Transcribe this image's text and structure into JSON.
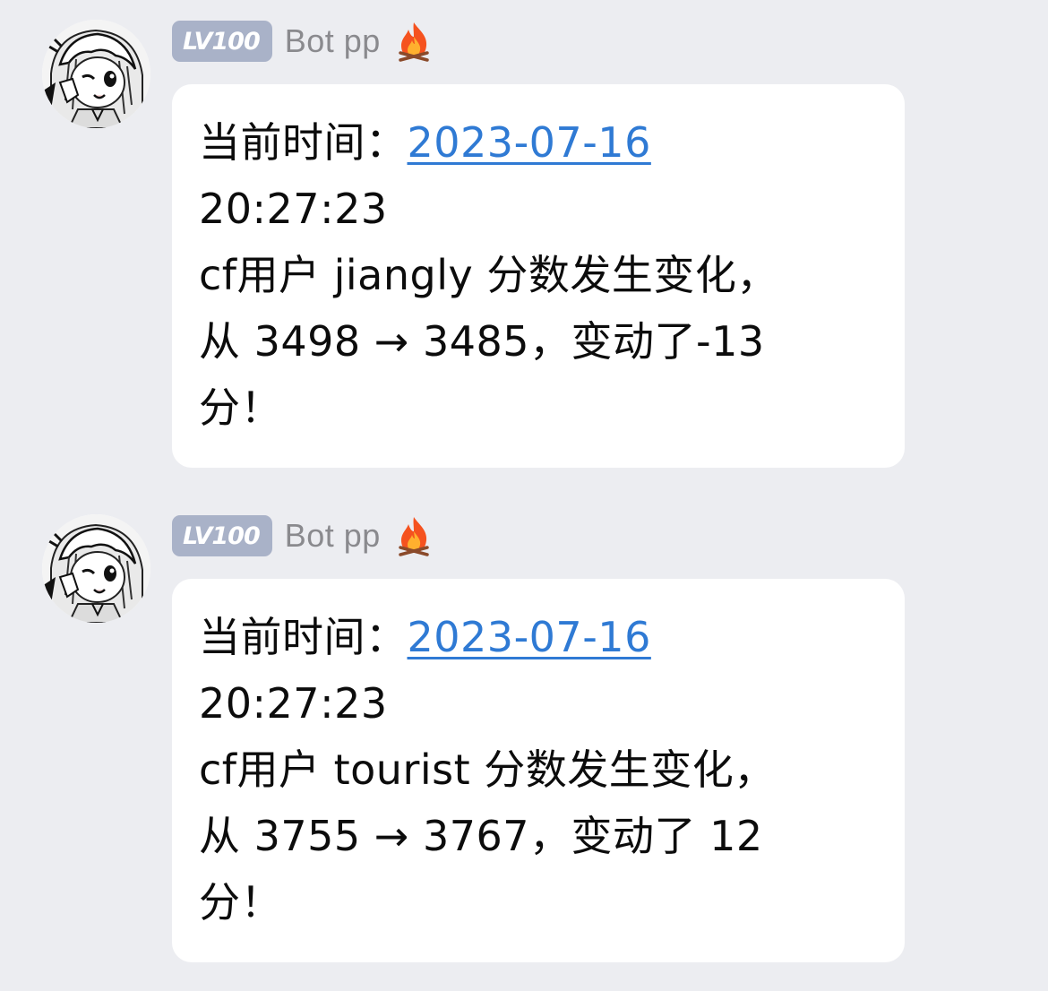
{
  "messages": [
    {
      "level_badge": "LV100",
      "sender": "Bot pp",
      "time_label": "当前时间：",
      "date": "2023-07-16",
      "time": "20:27:23",
      "line1": "cf用户 jiangly 分数发生变化，",
      "line2": "从 3498 → 3485，变动了-13",
      "line3": "分！",
      "flame_icon": "flame-icon",
      "avatar": "avatar"
    },
    {
      "level_badge": "LV100",
      "sender": "Bot pp",
      "time_label": "当前时间：",
      "date": "2023-07-16",
      "time": "20:27:23",
      "line1": "cf用户 tourist 分数发生变化，",
      "line2": "从 3755 → 3767，变动了 12",
      "line3": "分！",
      "flame_icon": "flame-icon",
      "avatar": "avatar"
    }
  ],
  "colors": {
    "background": "#ecedf1",
    "bubble": "#ffffff",
    "link": "#2f7ad4",
    "badge": "#a9b2c8",
    "sender": "#8a8a8e"
  }
}
